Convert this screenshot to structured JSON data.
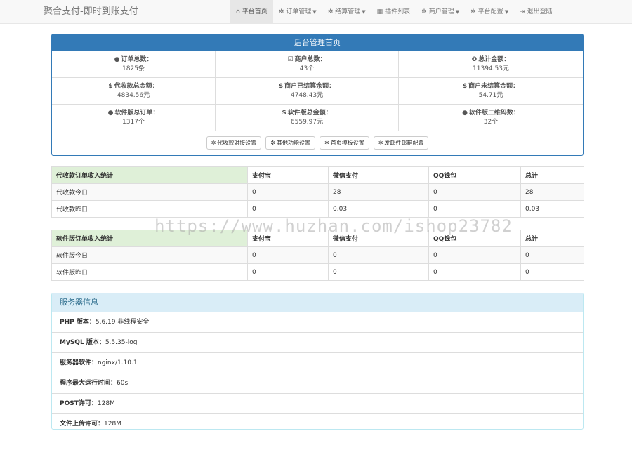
{
  "navbar": {
    "brand": "聚合支付-即时到账支付",
    "items": [
      {
        "icon": "⌂",
        "label": "平台首页",
        "caret": false,
        "active": true
      },
      {
        "icon": "✲",
        "label": "订单管理",
        "caret": true,
        "active": false
      },
      {
        "icon": "✲",
        "label": "结算管理",
        "caret": true,
        "active": false
      },
      {
        "icon": "▦",
        "label": "插件列表",
        "caret": false,
        "active": false
      },
      {
        "icon": "✲",
        "label": "商户管理",
        "caret": true,
        "active": false
      },
      {
        "icon": "✲",
        "label": "平台配置",
        "caret": true,
        "active": false
      },
      {
        "icon": "⇥",
        "label": "退出登陆",
        "caret": false,
        "active": false
      }
    ]
  },
  "overview": {
    "title": "后台管理首页",
    "stats": [
      {
        "icon": "●",
        "label": "订单总数：",
        "value": "1825条"
      },
      {
        "icon": "☑",
        "label": "商户总数：",
        "value": "43个"
      },
      {
        "icon": "❶",
        "label": "总计金额：",
        "value": "11394.53元"
      },
      {
        "icon": "$",
        "label": "代收款总金额：",
        "value": "4834.56元"
      },
      {
        "icon": "$",
        "label": "商户已结算余额：",
        "value": "4748.43元"
      },
      {
        "icon": "$",
        "label": "商户未结算金额：",
        "value": "54.71元"
      },
      {
        "icon": "●",
        "label": "软件版总订单：",
        "value": "1317个"
      },
      {
        "icon": "$",
        "label": "软件版总金额：",
        "value": "6559.97元"
      },
      {
        "icon": "●",
        "label": "软件版二维码数：",
        "value": "32个"
      }
    ],
    "buttons": [
      {
        "icon": "✲",
        "label": "代收款对接设置"
      },
      {
        "icon": "✲",
        "label": "其他功能设置"
      },
      {
        "icon": "✲",
        "label": "首页模板设置"
      },
      {
        "icon": "✲",
        "label": "发邮件邮箱配置"
      }
    ]
  },
  "daishou_table": {
    "headers": [
      "代收款订单收入统计",
      "支付宝",
      "微信支付",
      "QQ钱包",
      "总计"
    ],
    "rows": [
      [
        "代收款今日",
        "0",
        "28",
        "0",
        "28"
      ],
      [
        "代收款昨日",
        "0",
        "0.03",
        "0",
        "0.03"
      ]
    ]
  },
  "software_table": {
    "headers": [
      "软件版订单收入统计",
      "支付宝",
      "微信支付",
      "QQ钱包",
      "总计"
    ],
    "rows": [
      [
        "软件版今日",
        "0",
        "0",
        "0",
        "0"
      ],
      [
        "软件版昨日",
        "0",
        "0",
        "0",
        "0"
      ]
    ]
  },
  "server_info": {
    "title": "服务器信息",
    "rows": [
      {
        "key": "PHP 版本：",
        "value": "5.6.19 非线程安全"
      },
      {
        "key": "MySQL 版本：",
        "value": "5.5.35-log"
      },
      {
        "key": "服务器软件：",
        "value": "nginx/1.10.1"
      },
      {
        "key": "程序最大运行时间：",
        "value": "60s"
      },
      {
        "key": "POST许可：",
        "value": "128M"
      },
      {
        "key": "文件上传许可：",
        "value": "128M"
      }
    ]
  },
  "watermark": "https://www.huzhan.com/ishop23782"
}
